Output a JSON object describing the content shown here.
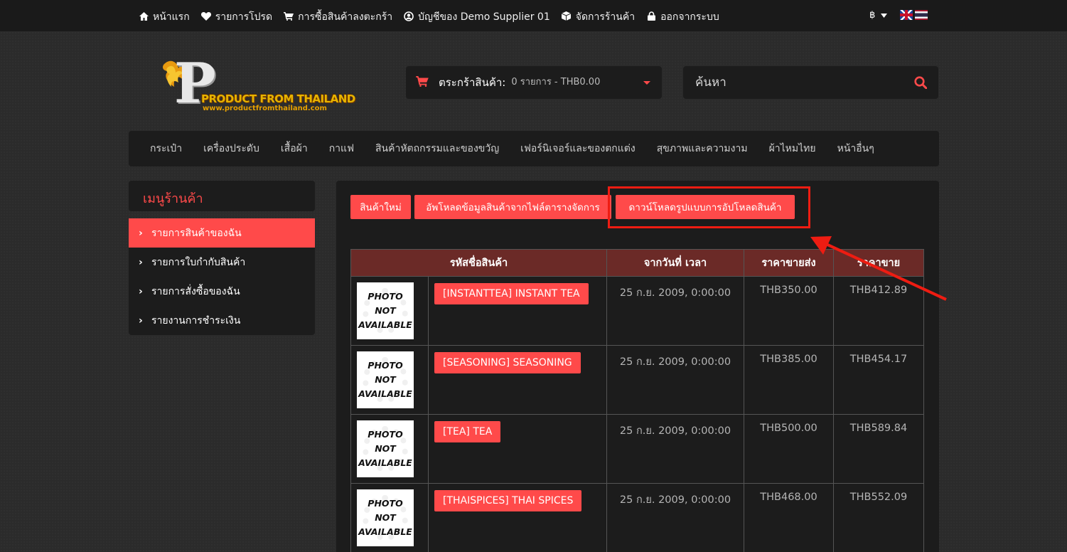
{
  "topnav": {
    "items": [
      {
        "label": "หน้าแรก",
        "icon": "home-icon"
      },
      {
        "label": "รายการโปรด",
        "icon": "heart-icon"
      },
      {
        "label": "การซื้อสินค้าลงตะกร้า",
        "icon": "cart-icon"
      },
      {
        "label": "บัญชีของ Demo Supplier 01",
        "icon": "user-circle-icon"
      },
      {
        "label": "จัดการร้านค้า",
        "icon": "cube-icon"
      },
      {
        "label": "ออกจากระบบ",
        "icon": "lock-icon"
      }
    ],
    "currency": "฿"
  },
  "logo": {
    "name": "PRODUCT FROM THAILAND",
    "url": "www.productfromthailand.com"
  },
  "cart": {
    "label": "ตระกร้าสินค้า:",
    "summary": "0 รายการ - THB0.00"
  },
  "search": {
    "placeholder": "ค้นหา"
  },
  "categories": [
    "กระเป๋า",
    "เครื่องประดับ",
    "เสื้อผ้า",
    "กาแฟ",
    "สินค้าหัตถกรรมและของขวัญ",
    "เฟอร์นิเจอร์และของตกแต่ง",
    "สุขภาพและความงาม",
    "ผ้าไหมไทย",
    "หน้าอื่นๆ"
  ],
  "sidebar": {
    "title": "เมนูร้านค้า",
    "items": [
      "รายการสินค้าของฉัน",
      "รายการใบกำกับสินค้า",
      "รายการสั่งซื้อของฉัน",
      "รายงานการชำระเงิน"
    ]
  },
  "actions": {
    "new_product": "สินค้าใหม่",
    "upload_table": "อัพโหลดข้อมูลสินค้าจากไฟล์ตารางจัดการ",
    "download_template": "ดาวน์โหลดรูปแบบการอัปโหลดสินค้า"
  },
  "table": {
    "headers": [
      "รหัสชื่อสินค้า",
      "จากวันที่ เวลา",
      "ราคาขายส่ง",
      "ราคาขาย"
    ],
    "photo_placeholder": [
      "PHOTO",
      "NOT",
      "AVAILABLE"
    ],
    "rows": [
      {
        "name": "[INSTANTTEA] INSTANT TEA",
        "date": "25 ก.ย. 2009, 0:00:00",
        "wholesale": "THB350.00",
        "price": "THB412.89"
      },
      {
        "name": "[SEASONING] SEASONING",
        "date": "25 ก.ย. 2009, 0:00:00",
        "wholesale": "THB385.00",
        "price": "THB454.17"
      },
      {
        "name": "[TEA] TEA",
        "date": "25 ก.ย. 2009, 0:00:00",
        "wholesale": "THB500.00",
        "price": "THB589.84"
      },
      {
        "name": "[THAISPICES] THAI SPICES",
        "date": "25 ก.ย. 2009, 0:00:00",
        "wholesale": "THB468.00",
        "price": "THB552.09"
      }
    ]
  },
  "colors": {
    "accent": "#ff4a4a",
    "header_row": "#6b2a27",
    "highlight": "#ee1c12"
  }
}
